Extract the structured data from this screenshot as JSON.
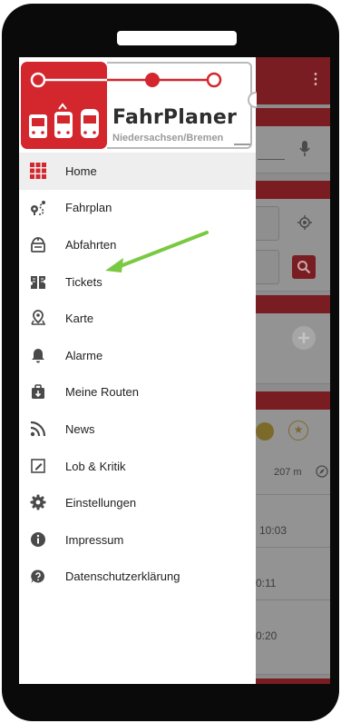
{
  "app": {
    "name": "FahrPlaner",
    "subtitle": "Niedersachsen/Bremen",
    "overflow_menu": "⋮"
  },
  "drawer": {
    "items": [
      {
        "label": "Home",
        "icon": "grid-icon",
        "active": true
      },
      {
        "label": "Fahrplan",
        "icon": "route-icon"
      },
      {
        "label": "Abfahrten",
        "icon": "departure-board-icon"
      },
      {
        "label": "Tickets",
        "icon": "tickets-icon"
      },
      {
        "label": "Karte",
        "icon": "map-pin-icon"
      },
      {
        "label": "Alarme",
        "icon": "bell-icon"
      },
      {
        "label": "Meine Routen",
        "icon": "saved-routes-icon"
      },
      {
        "label": "News",
        "icon": "rss-icon"
      },
      {
        "label": "Lob & Kritik",
        "icon": "feedback-icon"
      },
      {
        "label": "Einstellungen",
        "icon": "gear-icon"
      },
      {
        "label": "Impressum",
        "icon": "info-icon"
      },
      {
        "label": "Datenschutzerklärung",
        "icon": "privacy-icon"
      }
    ]
  },
  "background": {
    "distance": "207 m",
    "times": [
      "10:03",
      "0:11",
      "0:20"
    ]
  },
  "colors": {
    "brand_red": "#d3262d",
    "annotation_arrow": "#7ac943"
  }
}
